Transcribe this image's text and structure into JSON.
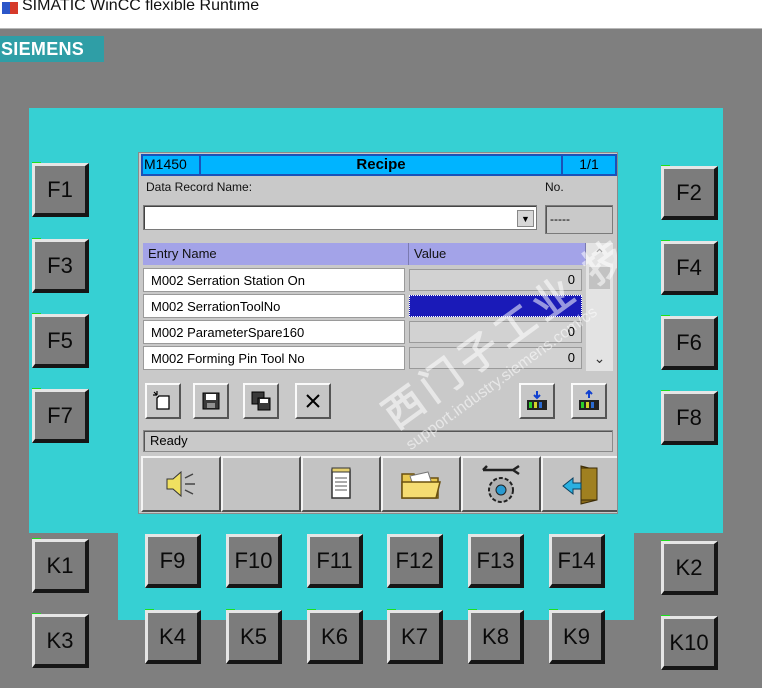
{
  "window": {
    "title": "SIMATIC WinCC flexible Runtime"
  },
  "brand": "SIEMENS",
  "screen": {
    "header": {
      "id": "M1450",
      "title": "Recipe",
      "page": "1/1"
    },
    "data_record_label": "Data Record Name:",
    "no_label": "No.",
    "record_name_value": "",
    "record_no_value": "-----",
    "table": {
      "headers": [
        "Entry Name",
        "Value"
      ],
      "rows": [
        {
          "name": "M002 Serration Station On",
          "value": "0"
        },
        {
          "name": "M002 SerrationToolNo",
          "value": ""
        },
        {
          "name": "M002 ParameterSpare160",
          "value": "0"
        },
        {
          "name": "M002 Forming Pin Tool No",
          "value": "0"
        }
      ]
    },
    "status": "Ready",
    "watermark": "西门子工业 技术论坛",
    "watermark_url": "support.industry.siemens.com/cs"
  },
  "keys": {
    "left": [
      "F1",
      "F3",
      "F5",
      "F7"
    ],
    "right": [
      "F2",
      "F4",
      "F6",
      "F8"
    ],
    "bottom_f": [
      "F9",
      "F10",
      "F11",
      "F12",
      "F13",
      "F14"
    ],
    "k_left": [
      "K1",
      "K3"
    ],
    "k_right": [
      "K2",
      "K10"
    ],
    "k_bottom": [
      "K4",
      "K5",
      "K6",
      "K7",
      "K8",
      "K9"
    ]
  },
  "colors": {
    "bezel": "#36d0d3",
    "led": "#1de01d",
    "header": "#00b4ff",
    "table_header": "#a3a3e8",
    "selection": "#1a1ab8"
  }
}
